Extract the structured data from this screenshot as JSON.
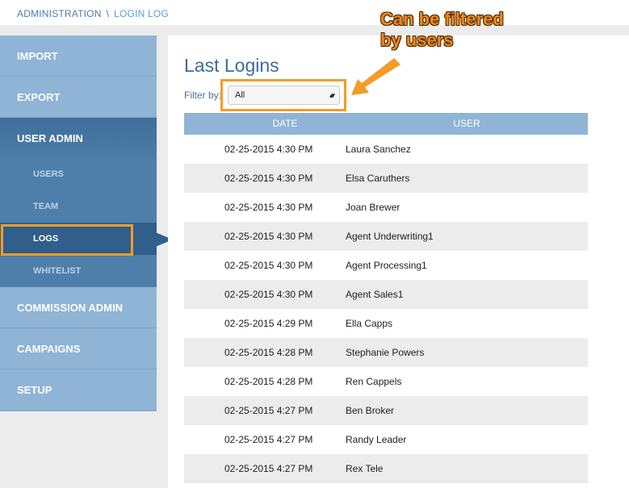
{
  "breadcrumb": {
    "parent": "ADMINISTRATION",
    "separator": "\\",
    "current": "LOGIN LOG"
  },
  "sidebar": {
    "items": [
      {
        "label": "IMPORT"
      },
      {
        "label": "EXPORT"
      },
      {
        "label": "USER ADMIN"
      },
      {
        "label": "COMMISSION ADMIN"
      },
      {
        "label": "CAMPAIGNS"
      },
      {
        "label": "SETUP"
      }
    ],
    "sub_items": [
      {
        "label": "USERS"
      },
      {
        "label": "TEAM"
      },
      {
        "label": "LOGS",
        "selected": true
      },
      {
        "label": "WHITELIST"
      }
    ]
  },
  "main": {
    "title": "Last Logins",
    "filter_label": "Filter by:",
    "filter_value": "All",
    "columns": [
      "DATE",
      "USER"
    ],
    "rows": [
      {
        "date": "02-25-2015 4:30 PM",
        "user": "Laura Sanchez"
      },
      {
        "date": "02-25-2015 4:30 PM",
        "user": "Elsa Caruthers"
      },
      {
        "date": "02-25-2015 4:30 PM",
        "user": "Joan Brewer"
      },
      {
        "date": "02-25-2015 4:30 PM",
        "user": "Agent Underwriting1"
      },
      {
        "date": "02-25-2015 4:30 PM",
        "user": "Agent Processing1"
      },
      {
        "date": "02-25-2015 4:30 PM",
        "user": "Agent Sales1"
      },
      {
        "date": "02-25-2015 4:29 PM",
        "user": "Ella Capps"
      },
      {
        "date": "02-25-2015 4:28 PM",
        "user": "Stephanie Powers"
      },
      {
        "date": "02-25-2015 4:28 PM",
        "user": "Ren Cappels"
      },
      {
        "date": "02-25-2015 4:27 PM",
        "user": "Ben Broker"
      },
      {
        "date": "02-25-2015 4:27 PM",
        "user": "Randy Leader"
      },
      {
        "date": "02-25-2015 4:27 PM",
        "user": "Rex Tele"
      }
    ]
  },
  "annotation": {
    "line1": "Can be filtered",
    "line2": "by users"
  },
  "colors": {
    "accent_orange": "#f39c28",
    "sidebar_blue": "#8fb4d5",
    "active_blue": "#2f5f8a"
  }
}
